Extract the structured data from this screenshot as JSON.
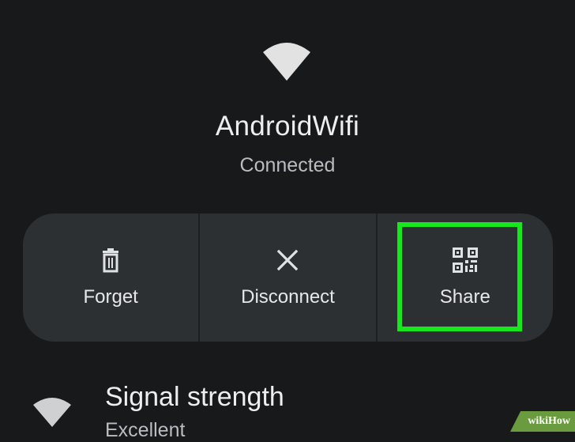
{
  "network": {
    "name": "AndroidWifi",
    "status": "Connected",
    "icon": "wifi-icon"
  },
  "actions": [
    {
      "label": "Forget",
      "icon": "trash-icon"
    },
    {
      "label": "Disconnect",
      "icon": "close-icon"
    },
    {
      "label": "Share",
      "icon": "qr-code-icon"
    }
  ],
  "highlight_color": "#16e81c",
  "details": {
    "signal": {
      "title": "Signal strength",
      "value": "Excellent",
      "icon": "wifi-icon"
    }
  },
  "watermark": {
    "text": "wikiHow"
  },
  "colors": {
    "background": "#17191b",
    "panel": "#2d3033",
    "text": "#eceef0"
  }
}
